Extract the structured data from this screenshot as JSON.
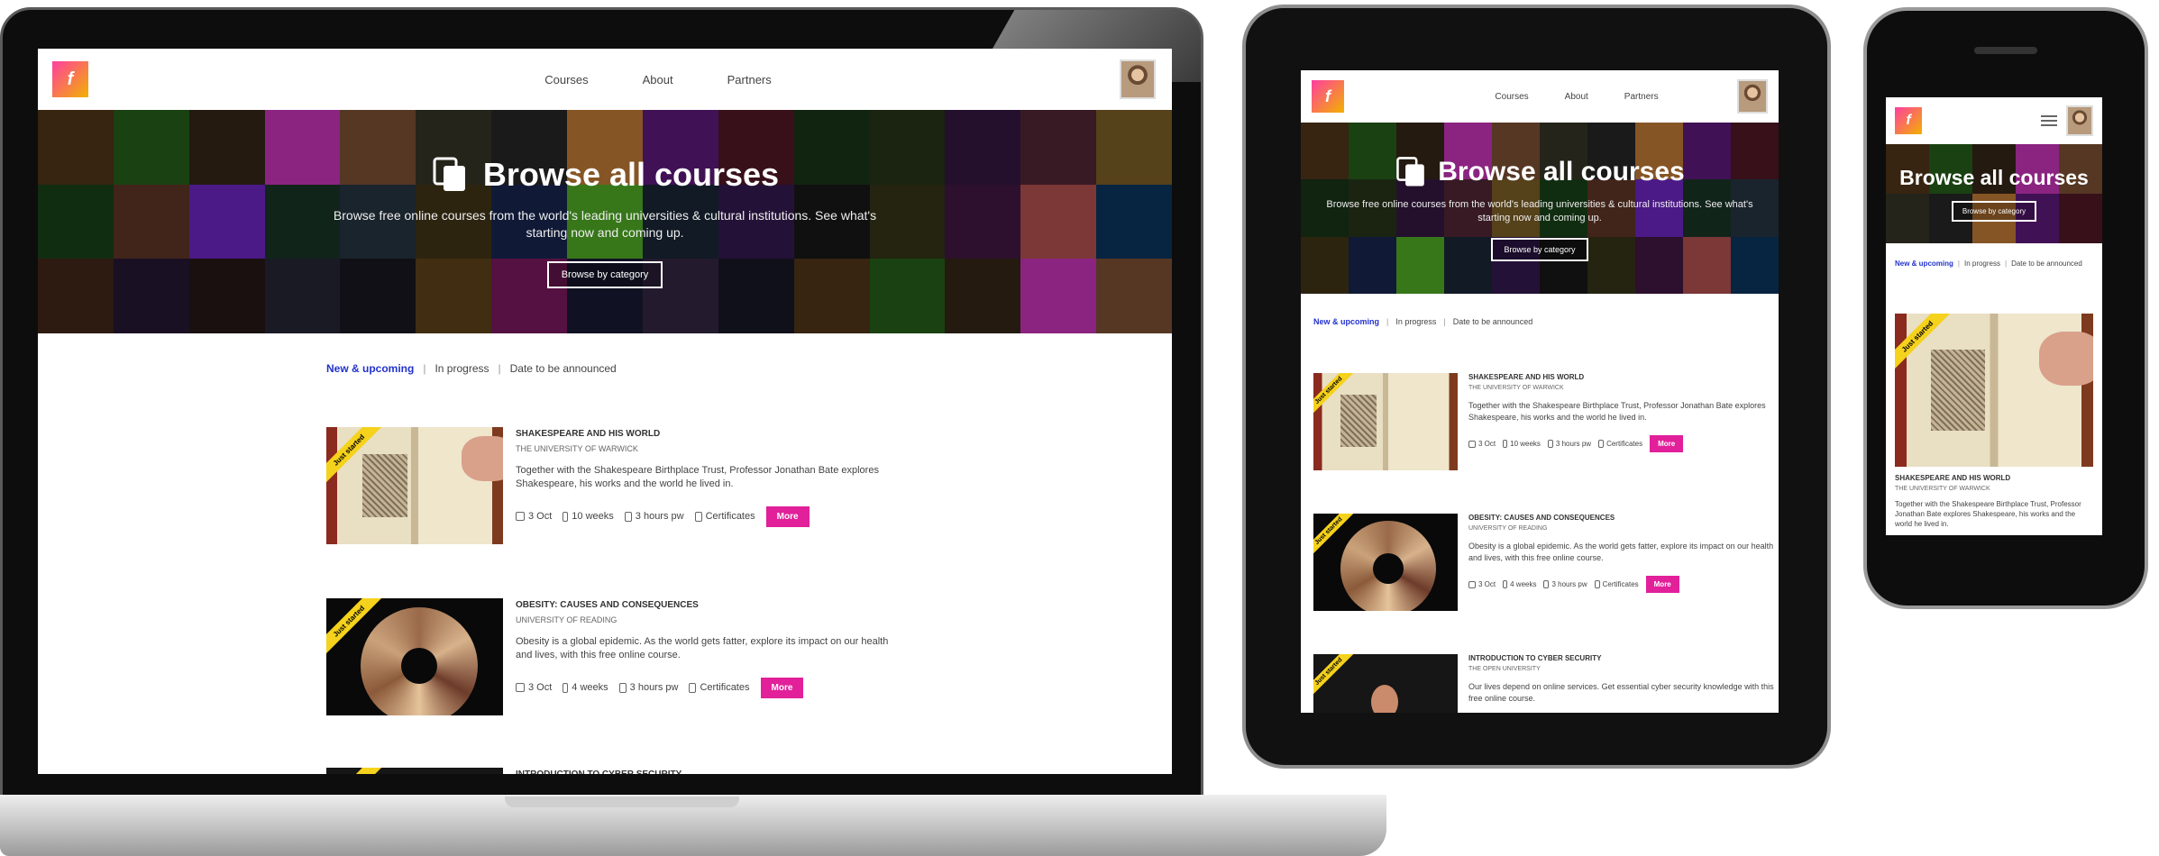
{
  "nav": {
    "courses": "Courses",
    "about": "About",
    "partners": "Partners",
    "menu_icon": "hamburger-icon"
  },
  "hero": {
    "title": "Browse all courses",
    "subtitle": "Browse free online courses from the world's leading universities & cultural institutions. See what's starting now and coming up.",
    "button": "Browse by category",
    "icon": "courses-stack-icon"
  },
  "filters": {
    "tab1": "New & upcoming",
    "tab2": "In progress",
    "tab3": "Date to be announced",
    "sep": "|"
  },
  "courses": [
    {
      "title": "Shakespeare and his world",
      "university": "The University of Warwick",
      "description": "Together with the Shakespeare Birthplace Trust, Professor Jonathan Bate explores Shakespeare, his works and the world he lived in.",
      "start": "3 Oct",
      "weeks": "10 weeks",
      "hours": "3 hours pw",
      "cert": "Certificates",
      "ribbon": "Just started",
      "more": "More"
    },
    {
      "title": "Obesity: causes and consequences",
      "university": "University of Reading",
      "description": "Obesity is a global epidemic. As the world gets fatter, explore its impact on our health and lives, with this free online course.",
      "start": "3 Oct",
      "weeks": "4 weeks",
      "hours": "3 hours pw",
      "cert": "Certificates",
      "ribbon": "Just started",
      "more": "More"
    },
    {
      "title": "Introduction to cyber security",
      "university": "The Open University",
      "description": "Our lives depend on online services. Get essential cyber security knowledge with this free online course.",
      "ribbon": "Just started"
    }
  ],
  "colors": {
    "accent": "#e1209a",
    "active_tab": "#2233cc",
    "ribbon": "#f5d21b"
  },
  "mosaic": [
    "#2b3a1c",
    "#1a1a24",
    "#7a2ad8",
    "#5a3a1c",
    "#1c2a3c",
    "#2a2a2a",
    "#0c3a6a",
    "#3a1a4a",
    "#6a4a1c",
    "#1c3a2a",
    "#2a6a1c",
    "#3a1c5a",
    "#d88a3c",
    "#4a2a1a",
    "#5a2a3a",
    "#8a1c6a",
    "#2a3a4a",
    "#3a2a1a",
    "#1a1a1a",
    "#6a1c8a",
    "#2a1a3a",
    "#8a6a2a",
    "#1c1c3a",
    "#4a3a1a",
    "#e03ad0",
    "#3a3a1a",
    "#5a1a2a",
    "#2a1a1a",
    "#1c4a1c",
    "#3a2a4a",
    "#1a2a5a",
    "#8a5a3a",
    "#4a1a4a",
    "#1a3a1a",
    "#2a2a3a",
    "#6a3a2a",
    "#1a1a2a",
    "#5ac02a",
    "#3a3a2a",
    "#c85a5a"
  ]
}
